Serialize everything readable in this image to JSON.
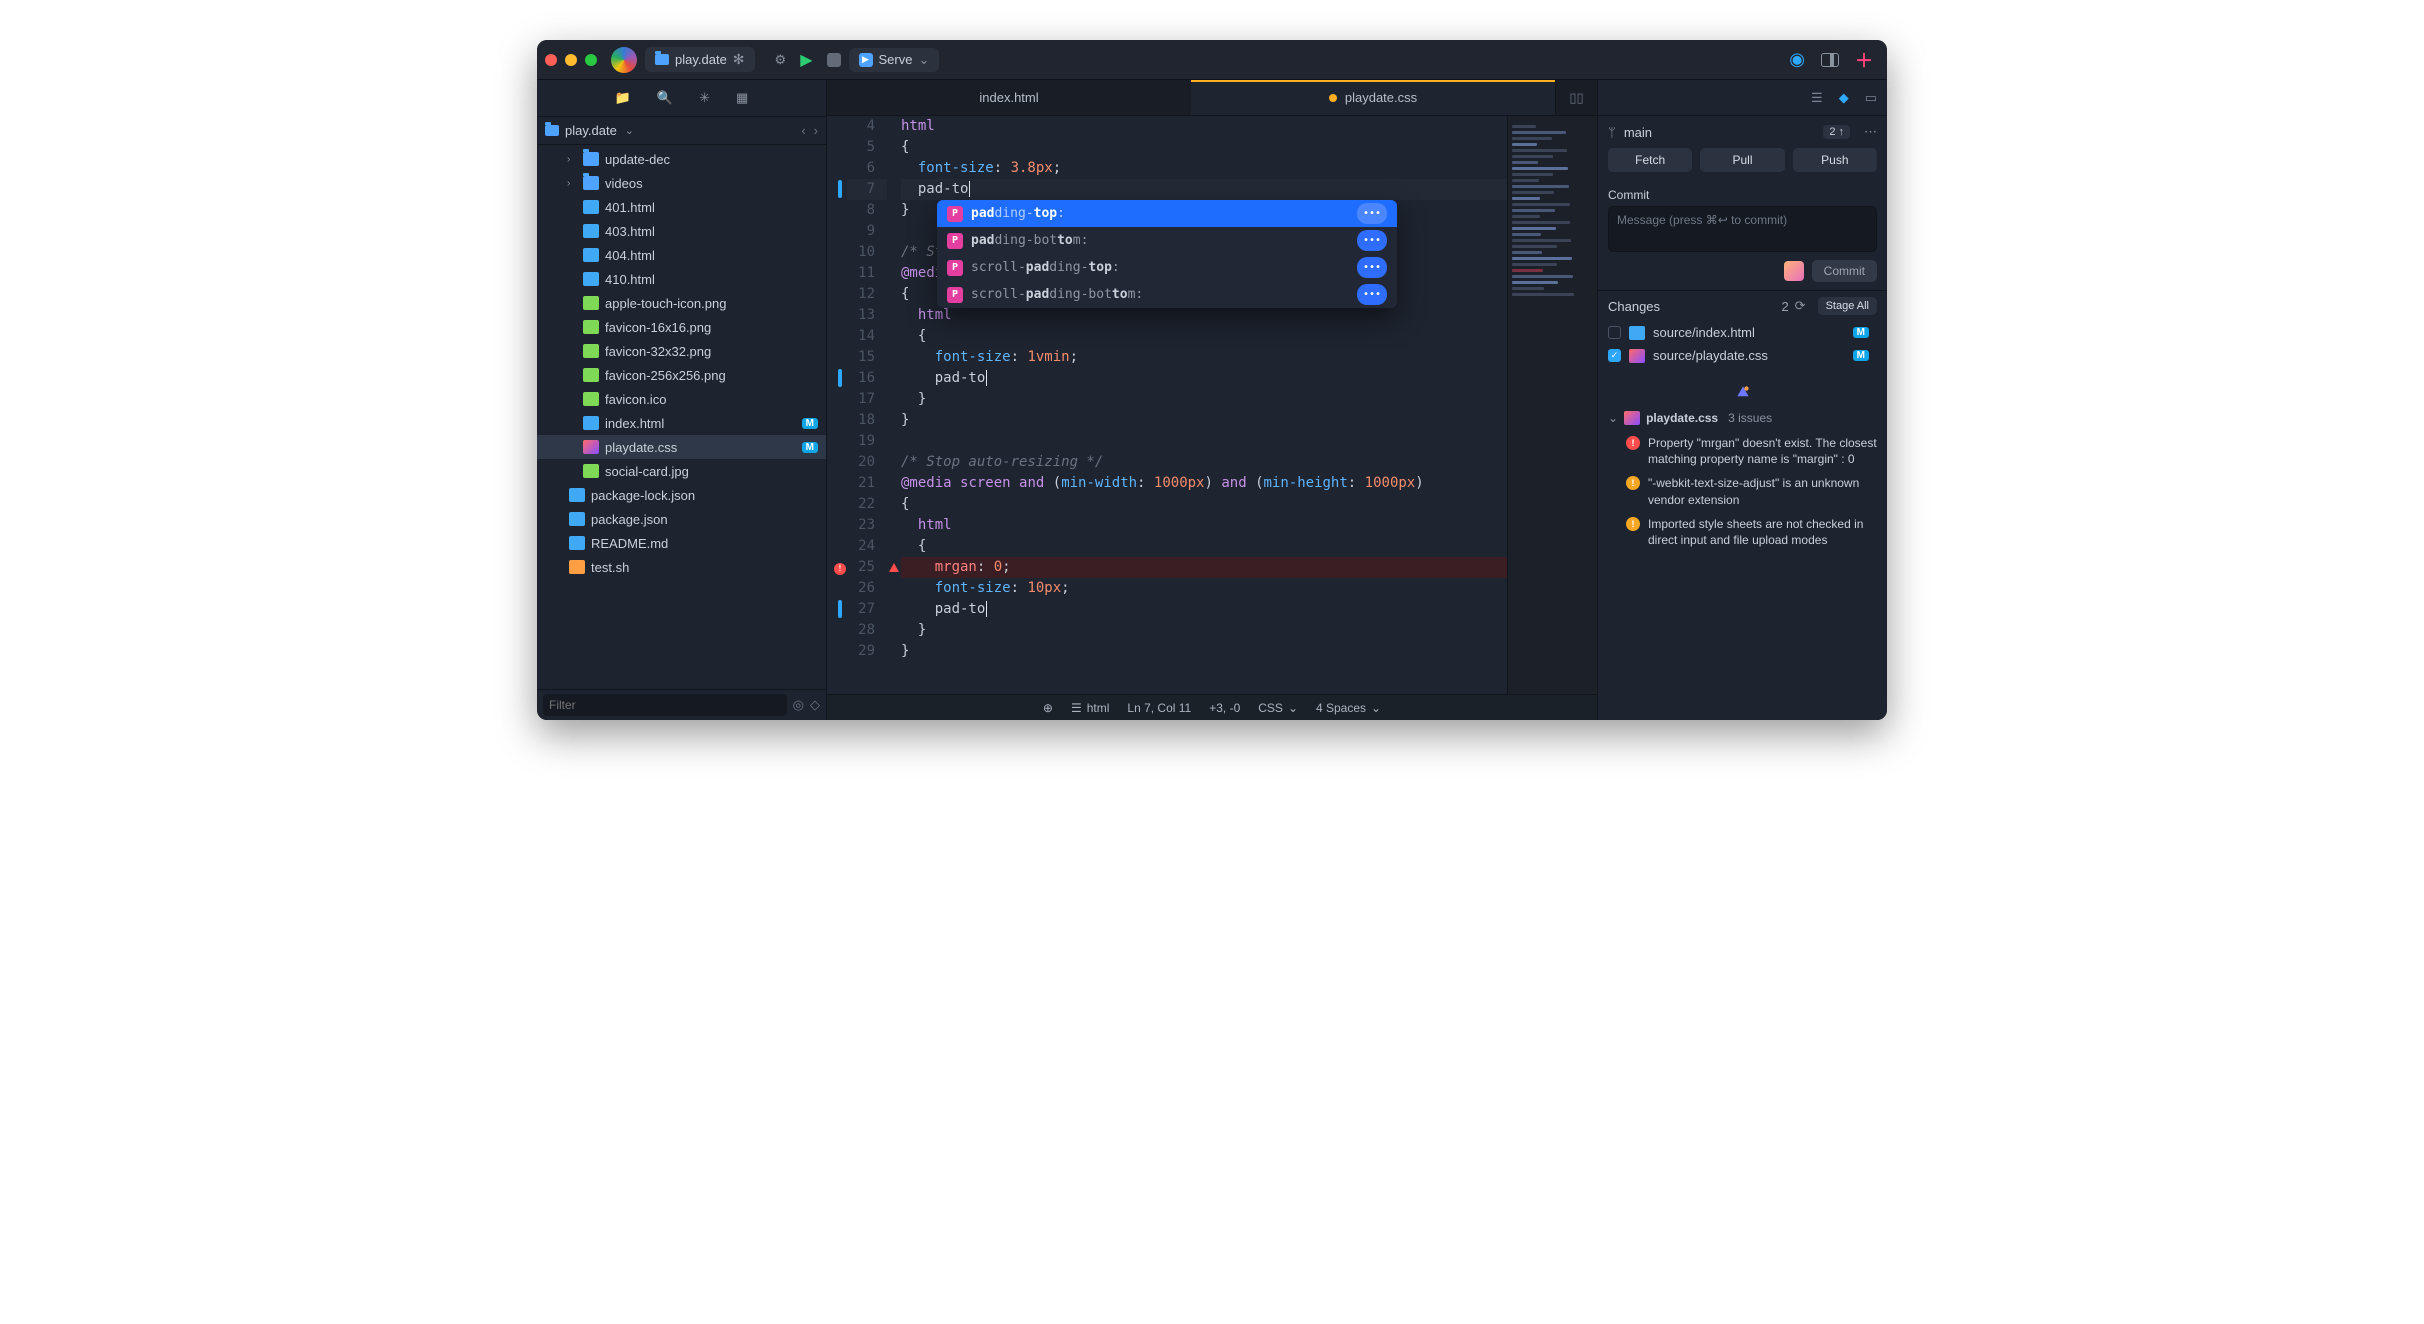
{
  "titlebar": {
    "project_tab": "play.date",
    "serve_label": "Serve"
  },
  "sidebar": {
    "path_name": "play.date",
    "filter_placeholder": "Filter",
    "tree": [
      {
        "depth": 1,
        "disclose": "›",
        "icon": "folder",
        "name": "update-dec"
      },
      {
        "depth": 1,
        "disclose": "›",
        "icon": "folder",
        "name": "videos"
      },
      {
        "depth": 1,
        "icon": "html",
        "name": "401.html"
      },
      {
        "depth": 1,
        "icon": "html",
        "name": "403.html"
      },
      {
        "depth": 1,
        "icon": "html",
        "name": "404.html"
      },
      {
        "depth": 1,
        "icon": "html",
        "name": "410.html"
      },
      {
        "depth": 1,
        "icon": "png",
        "name": "apple-touch-icon.png"
      },
      {
        "depth": 1,
        "icon": "png",
        "name": "favicon-16x16.png"
      },
      {
        "depth": 1,
        "icon": "png",
        "name": "favicon-32x32.png"
      },
      {
        "depth": 1,
        "icon": "png",
        "name": "favicon-256x256.png"
      },
      {
        "depth": 1,
        "icon": "ico",
        "name": "favicon.ico"
      },
      {
        "depth": 1,
        "icon": "html",
        "name": "index.html",
        "badge": "M"
      },
      {
        "depth": 1,
        "icon": "css",
        "name": "playdate.css",
        "badge": "M",
        "selected": true
      },
      {
        "depth": 1,
        "icon": "jpg",
        "name": "social-card.jpg"
      },
      {
        "depth": 0,
        "icon": "json",
        "name": "package-lock.json"
      },
      {
        "depth": 0,
        "icon": "json",
        "name": "package.json"
      },
      {
        "depth": 0,
        "icon": "md",
        "name": "README.md"
      },
      {
        "depth": 0,
        "icon": "sh",
        "name": "test.sh"
      }
    ]
  },
  "tabs": [
    {
      "label": "index.html",
      "active": false,
      "modified": false
    },
    {
      "label": "playdate.css",
      "active": true,
      "modified": true
    }
  ],
  "code": {
    "lines": [
      {
        "n": 4,
        "html": "<span class='tk-sel'>html</span>"
      },
      {
        "n": 5,
        "html": "{"
      },
      {
        "n": 6,
        "html": "  <span class='tk-prop'>font-size</span>: <span class='tk-num'>3.8px</span>;"
      },
      {
        "n": 7,
        "hl": true,
        "gutter": "bar",
        "html": "  pad-to<span class='cursor'></span>"
      },
      {
        "n": 8,
        "html": "}"
      },
      {
        "n": 9,
        "html": ""
      },
      {
        "n": 10,
        "html": "<span class='tk-comment'>/* St</span>"
      },
      {
        "n": 11,
        "html": "<span class='tk-at'>@medi</span>                                             <span class='tk-num'>px</span>)"
      },
      {
        "n": 12,
        "html": "{"
      },
      {
        "n": 13,
        "html": "  <span class='tk-sel'>html</span>"
      },
      {
        "n": 14,
        "html": "  {"
      },
      {
        "n": 15,
        "html": "    <span class='tk-prop'>font-size</span>: <span class='tk-num'>1vmin</span>;"
      },
      {
        "n": 16,
        "gutter": "bar",
        "html": "    pad-to<span class='cursor'></span>"
      },
      {
        "n": 17,
        "html": "  }"
      },
      {
        "n": 18,
        "html": "}"
      },
      {
        "n": 19,
        "html": ""
      },
      {
        "n": 20,
        "html": "<span class='tk-comment'>/* Stop auto-resizing */</span>"
      },
      {
        "n": 21,
        "html": "<span class='tk-at'>@media</span> <span class='tk-kw'>screen</span> <span class='tk-kw'>and</span> (<span class='tk-prop'>min-width</span>: <span class='tk-num'>1000px</span>) <span class='tk-kw'>and</span> (<span class='tk-prop'>min-height</span>: <span class='tk-num'>1000px</span>)"
      },
      {
        "n": 22,
        "html": "{"
      },
      {
        "n": 23,
        "html": "  <span class='tk-sel'>html</span>"
      },
      {
        "n": 24,
        "html": "  {"
      },
      {
        "n": 25,
        "errline": true,
        "gutter": "err",
        "warn": true,
        "html": "    <span class='tk-err'>mrgan</span>: <span class='tk-num'>0</span>;"
      },
      {
        "n": 26,
        "html": "    <span class='tk-prop'>font-size</span>: <span class='tk-num'>10px</span>;"
      },
      {
        "n": 27,
        "gutter": "bar",
        "html": "    pad-to<span class='cursor'></span>"
      },
      {
        "n": 28,
        "html": "  }"
      },
      {
        "n": 29,
        "html": "}"
      }
    ]
  },
  "autocomplete": [
    {
      "sel": true,
      "pre": "pad",
      "mid": "ding-",
      "suf": "top",
      "rest": ":"
    },
    {
      "pre": "pad",
      "mid": "ding-bot",
      "suf": "to",
      "rest": "m:"
    },
    {
      "pre": "",
      "mid": "scroll-",
      "suf": "pad",
      "mid2": "ding-",
      "suf2": "top",
      "rest": ":"
    },
    {
      "pre": "",
      "mid": "scroll-",
      "suf": "pad",
      "mid2": "ding-bot",
      "suf2": "to",
      "rest": "m:"
    }
  ],
  "statusbar": {
    "lang_hint": "html",
    "pos": "Ln 7, Col 11",
    "diff": "+3, -0",
    "syntax": "CSS",
    "indent": "4 Spaces"
  },
  "scm": {
    "branch": "main",
    "ahead": "2 ↑",
    "fetch": "Fetch",
    "pull": "Pull",
    "push": "Push",
    "commit_head": "Commit",
    "commit_placeholder": "Message (press ⌘↩ to commit)",
    "commit_btn": "Commit",
    "changes_head": "Changes",
    "changes_count": "2",
    "stage_all": "Stage All",
    "changes": [
      {
        "checked": false,
        "icon": "html",
        "path": "source/index.html",
        "badge": "M"
      },
      {
        "checked": true,
        "icon": "css",
        "path": "source/playdate.css",
        "badge": "M"
      }
    ]
  },
  "issues": {
    "file": "playdate.css",
    "count": "3 issues",
    "items": [
      {
        "type": "err",
        "text": "Property \"mrgan\" doesn't exist. The closest matching property name is \"margin\" : 0"
      },
      {
        "type": "warn",
        "text": "\"-webkit-text-size-adjust\" is an unknown vendor extension"
      },
      {
        "type": "warn",
        "text": "Imported style sheets are not checked in direct input and file upload modes"
      }
    ]
  }
}
